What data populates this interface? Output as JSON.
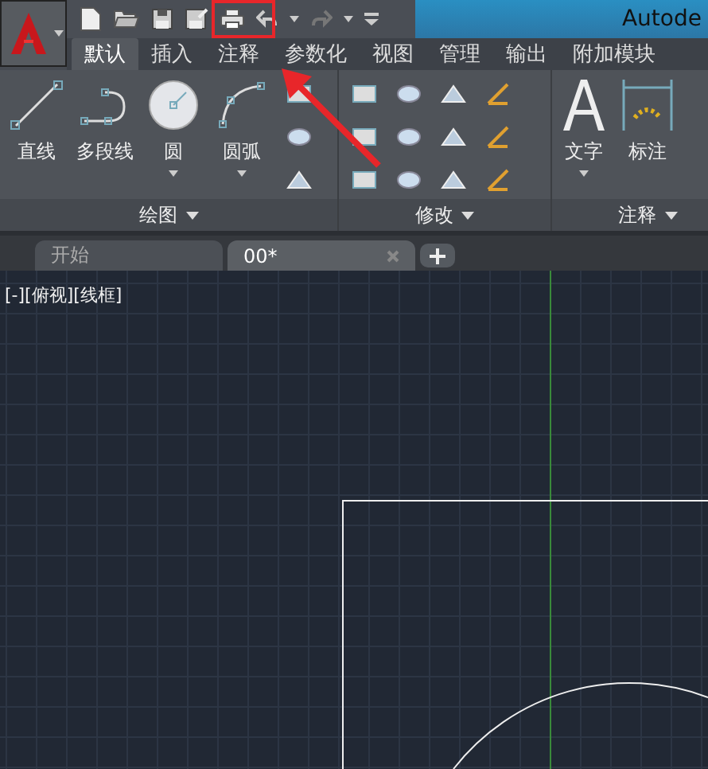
{
  "window": {
    "title": "Autode"
  },
  "tabs": [
    {
      "label": "默认",
      "selected": true
    },
    {
      "label": "插入",
      "selected": false
    },
    {
      "label": "注释",
      "selected": false
    },
    {
      "label": "参数化",
      "selected": false
    },
    {
      "label": "视图",
      "selected": false
    },
    {
      "label": "管理",
      "selected": false
    },
    {
      "label": "输出",
      "selected": false
    },
    {
      "label": "附加模块",
      "selected": false
    }
  ],
  "panels": [
    {
      "kind": "draw",
      "title": "绘图",
      "large_tools": [
        {
          "kind": "line",
          "label": "直线",
          "dropdown": false
        },
        {
          "kind": "polyline",
          "label": "多段线",
          "dropdown": false
        },
        {
          "kind": "circle",
          "label": "圆",
          "dropdown": true
        },
        {
          "kind": "arc",
          "label": "圆弧",
          "dropdown": true
        }
      ]
    },
    {
      "kind": "modify",
      "title": "修改"
    },
    {
      "kind": "annotate",
      "title": "注释",
      "large_tools": [
        {
          "kind": "text",
          "label": "文字",
          "dropdown": true
        },
        {
          "kind": "dimension",
          "label": "标注",
          "dropdown": false
        }
      ]
    }
  ],
  "doc_tabs": [
    {
      "label": "开始",
      "selected": false,
      "closable": false
    },
    {
      "label": "00*",
      "selected": true,
      "closable": true
    }
  ],
  "viewport": {
    "label": "[-][俯视][线框]"
  }
}
